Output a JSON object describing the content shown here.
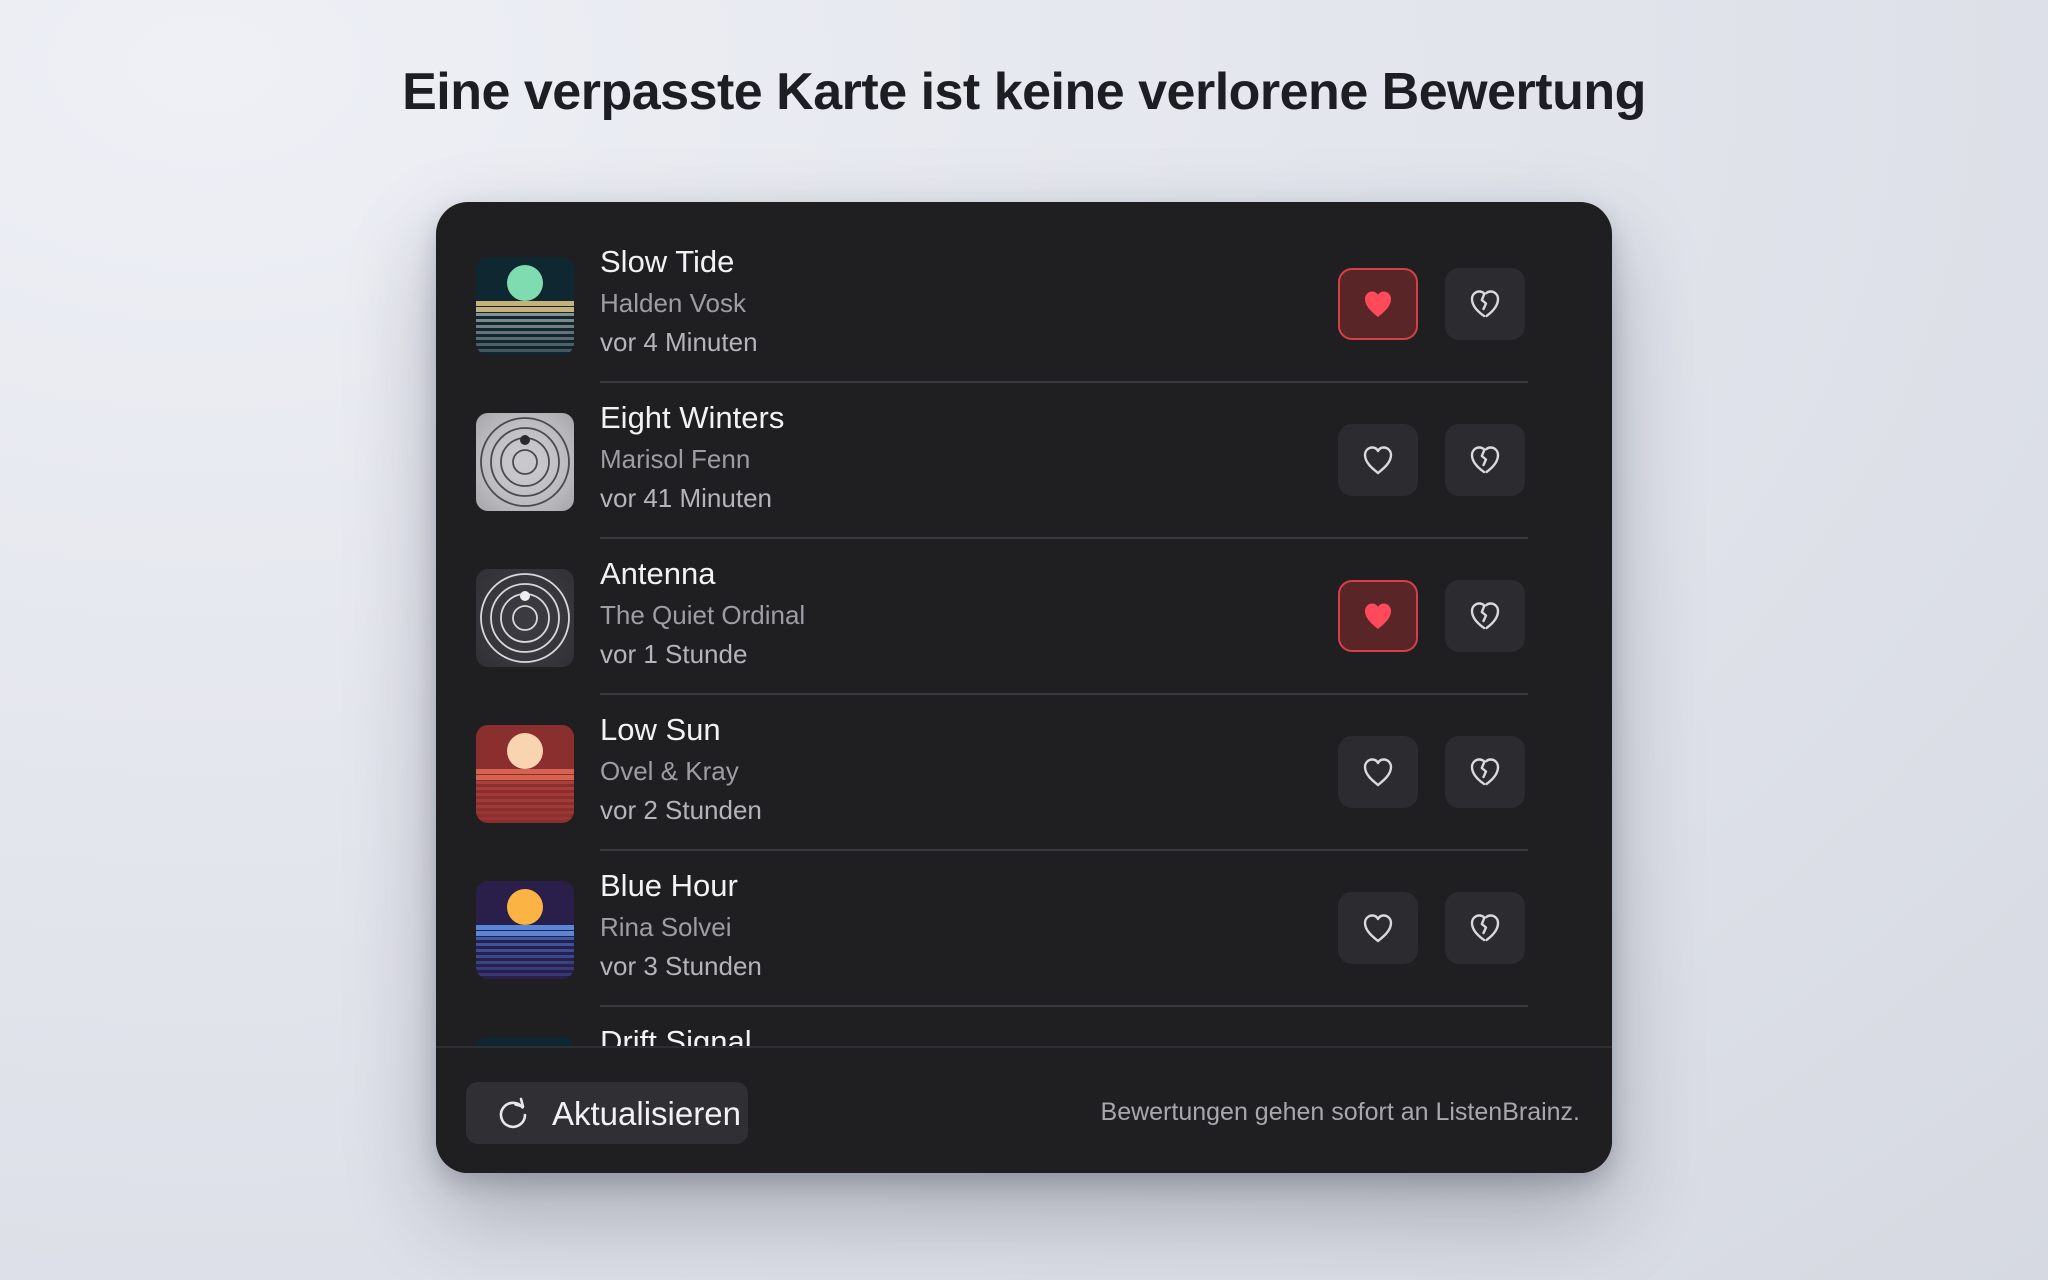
{
  "heading": "Eine verpasste Karte ist keine verlorene Bewertung",
  "tracks": [
    {
      "title": "Slow Tide",
      "artist": "Halden Vosk",
      "time": "vor 4 Minuten",
      "loved": true,
      "art": "stripes-sun",
      "art_colors": {
        "bg": "#0f2730",
        "sun": "#7fdcb0",
        "stripe1": "#c4b27a",
        "stripe2": "#8a9092"
      }
    },
    {
      "title": "Eight Winters",
      "artist": "Marisol Fenn",
      "time": "vor 41 Minuten",
      "loved": false,
      "art": "rings",
      "art_colors": {
        "bg": "#c9c9cd",
        "ring": "#4a4a50",
        "dot": "#2a2a2e"
      }
    },
    {
      "title": "Antenna",
      "artist": "The Quiet Ordinal",
      "time": "vor 1 Stunde",
      "loved": true,
      "art": "rings",
      "art_colors": {
        "bg": "#3a3a40",
        "ring": "#d8d8dc",
        "dot": "#f0f0f2"
      }
    },
    {
      "title": "Low Sun",
      "artist": "Ovel & Kray",
      "time": "vor 2 Stunden",
      "loved": false,
      "art": "stripes-sun",
      "art_colors": {
        "bg": "#8a2e2e",
        "sun": "#f9d4b0",
        "stripe1": "#d66350",
        "stripe2": "#a8403c"
      }
    },
    {
      "title": "Blue Hour",
      "artist": "Rina Solvei",
      "time": "vor 3 Stunden",
      "loved": false,
      "art": "stripes-sun",
      "art_colors": {
        "bg": "#2a1e4a",
        "sun": "#fbb444",
        "stripe1": "#5a86d6",
        "stripe2": "#3d5aa6"
      }
    },
    {
      "title": "Drift Signal",
      "artist": "",
      "time": "",
      "loved": false,
      "art": "stripes-sun",
      "art_colors": {
        "bg": "#0f2730",
        "sun": "#0f2730",
        "stripe1": "#0f2730",
        "stripe2": "#0f2730"
      }
    }
  ],
  "love_icon": "heart-icon",
  "hate_icon": "broken-heart-icon",
  "colors": {
    "heart_active": "#ff4a5c",
    "heart_outline": "#d9d9de"
  },
  "footer": {
    "refresh_label": "Aktualisieren",
    "refresh_icon": "refresh-icon",
    "note": "Bewertungen gehen sofort an ListenBrainz."
  }
}
